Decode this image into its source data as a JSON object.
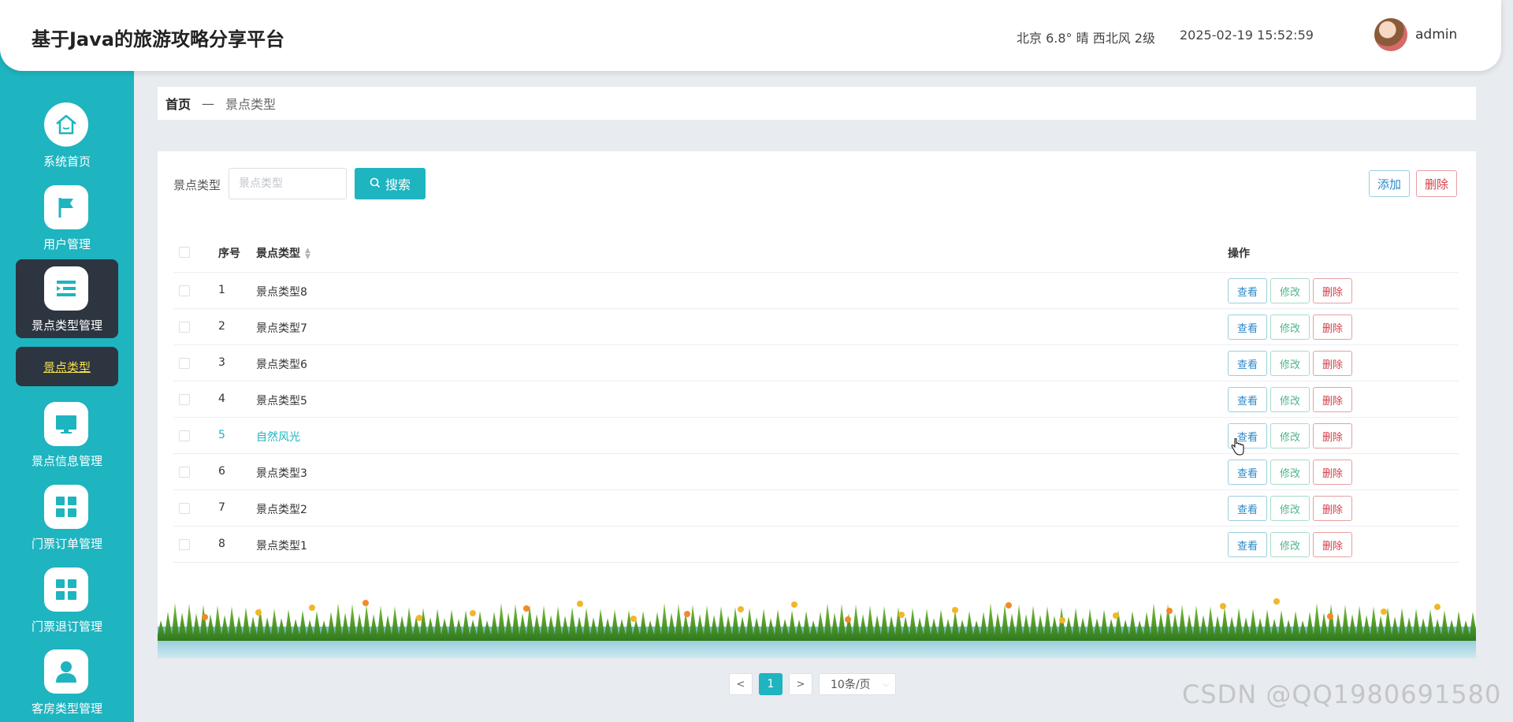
{
  "header": {
    "title": "基于Java的旅游攻略分享平台",
    "weather": "北京  6.8°  晴  西北风  2级",
    "datetime": "2025-02-19 15:52:59",
    "username": "admin"
  },
  "sidebar": {
    "items": [
      {
        "label": "系统首页",
        "icon": "home-icon"
      },
      {
        "label": "用户管理",
        "icon": "flag-icon"
      },
      {
        "label": "景点类型管理",
        "icon": "list-icon"
      },
      {
        "label": "景点信息管理",
        "icon": "monitor-icon"
      },
      {
        "label": "门票订单管理",
        "icon": "grid-icon"
      },
      {
        "label": "门票退订管理",
        "icon": "grid-icon"
      },
      {
        "label": "客房类型管理",
        "icon": "user-icon"
      }
    ],
    "submenu_label": "景点类型"
  },
  "breadcrumb": {
    "home": "首页",
    "separator": "—",
    "current": "景点类型"
  },
  "search": {
    "label": "景点类型",
    "placeholder": "景点类型",
    "button_label": "搜索"
  },
  "toolbar": {
    "add_label": "添加",
    "delete_label": "删除"
  },
  "table": {
    "columns": [
      "序号",
      "景点类型",
      "操作"
    ],
    "rows": [
      {
        "no": "1",
        "type": "景点类型8"
      },
      {
        "no": "2",
        "type": "景点类型7"
      },
      {
        "no": "3",
        "type": "景点类型6"
      },
      {
        "no": "4",
        "type": "景点类型5"
      },
      {
        "no": "5",
        "type": "自然风光"
      },
      {
        "no": "6",
        "type": "景点类型3"
      },
      {
        "no": "7",
        "type": "景点类型2"
      },
      {
        "no": "8",
        "type": "景点类型1"
      }
    ],
    "actions": {
      "view": "查看",
      "edit": "修改",
      "delete": "删除"
    }
  },
  "pagination": {
    "prev": "<",
    "current_page": "1",
    "next": ">",
    "page_size": "10条/页"
  },
  "watermark": "CSDN @QQ1980691580",
  "colors": {
    "accent": "#1eb4c0",
    "sidebar_active": "#2c3540",
    "submenu_text": "#f5e04a",
    "danger": "#d43f4a"
  }
}
